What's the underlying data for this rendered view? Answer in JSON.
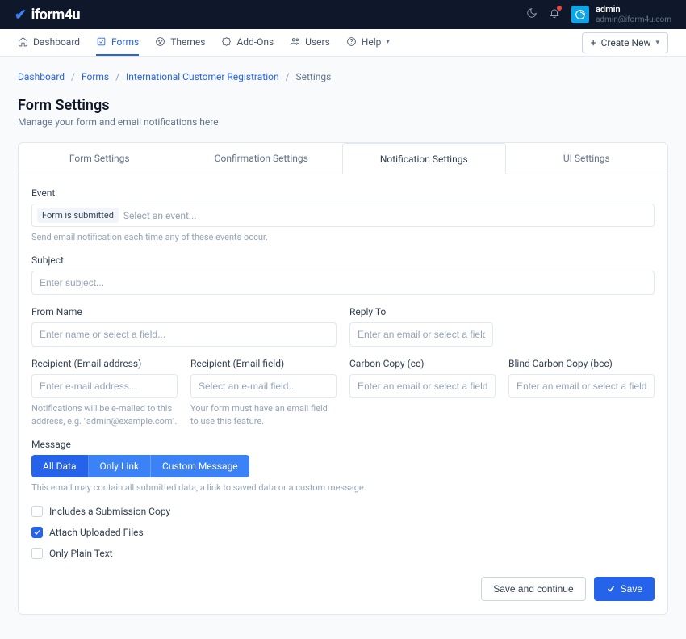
{
  "brand": {
    "name_a": "ifor",
    "name_b": "m",
    "name_c": "4",
    "name_d": "u"
  },
  "user": {
    "name": "admin",
    "email": "admin@iform4u.com"
  },
  "nav": {
    "items": [
      {
        "label": "Dashboard"
      },
      {
        "label": "Forms"
      },
      {
        "label": "Themes"
      },
      {
        "label": "Add-Ons"
      },
      {
        "label": "Users"
      },
      {
        "label": "Help"
      }
    ],
    "create": "Create New"
  },
  "breadcrumb": {
    "dashboard": "Dashboard",
    "forms": "Forms",
    "form_name": "International Customer Registration",
    "current": "Settings"
  },
  "page": {
    "title": "Form Settings",
    "subtitle": "Manage your form and email notifications here"
  },
  "tabs": {
    "form": "Form Settings",
    "confirmation": "Confirmation Settings",
    "notification": "Notification Settings",
    "ui": "UI Settings"
  },
  "event": {
    "label": "Event",
    "tag": "Form is submitted",
    "placeholder": "Select an event...",
    "help": "Send email notification each time any of these events occur."
  },
  "subject": {
    "label": "Subject",
    "placeholder": "Enter subject..."
  },
  "from_name": {
    "label": "From Name",
    "placeholder": "Enter name or select a field..."
  },
  "reply_to": {
    "label": "Reply To",
    "placeholder": "Enter an email or select a field..."
  },
  "recipient_email": {
    "label": "Recipient (Email address)",
    "placeholder": "Enter e-mail address...",
    "help": "Notifications will be e-mailed to this address, e.g. \"admin@example.com\"."
  },
  "recipient_field": {
    "label": "Recipient (Email field)",
    "placeholder": "Select an e-mail field...",
    "help": "Your form must have an email field to use this feature."
  },
  "cc": {
    "label": "Carbon Copy (cc)",
    "placeholder": "Enter an email or select a field..."
  },
  "bcc": {
    "label": "Blind Carbon Copy (bcc)",
    "placeholder": "Enter an email or select a field..."
  },
  "message": {
    "label": "Message",
    "seg_all": "All Data",
    "seg_link": "Only Link",
    "seg_custom": "Custom Message",
    "help": "This email may contain all submitted data, a link to saved data or a custom message."
  },
  "checks": {
    "copy": "Includes a Submission Copy",
    "attach": "Attach Uploaded Files",
    "plain": "Only Plain Text"
  },
  "actions": {
    "save_continue": "Save and continue",
    "save": "Save"
  }
}
